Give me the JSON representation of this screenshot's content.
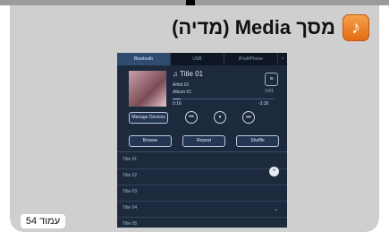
{
  "title": "מסך Media (מדיה)",
  "app_icon": "music-note-icon",
  "page_label": "עמוד 54",
  "device": {
    "tabs": [
      "Bluetooth",
      "USB",
      "iPod/iPhone"
    ],
    "track": {
      "title": "♫ Title 01",
      "artist": "Artist 01",
      "album": "Album 01",
      "time_elapsed": "0:16",
      "time_remaining": "-3:30",
      "side_number": "1/41",
      "progress": 0.08
    },
    "manage_devices_label": "Manage Devices",
    "controls": [
      "⏮",
      "⏸",
      "⏭"
    ],
    "buttons": [
      "Browse",
      "Repeat",
      "Shuffle"
    ],
    "list": [
      "Title 01",
      "Title 02",
      "Title 03",
      "Title 04",
      "Title 05"
    ]
  }
}
